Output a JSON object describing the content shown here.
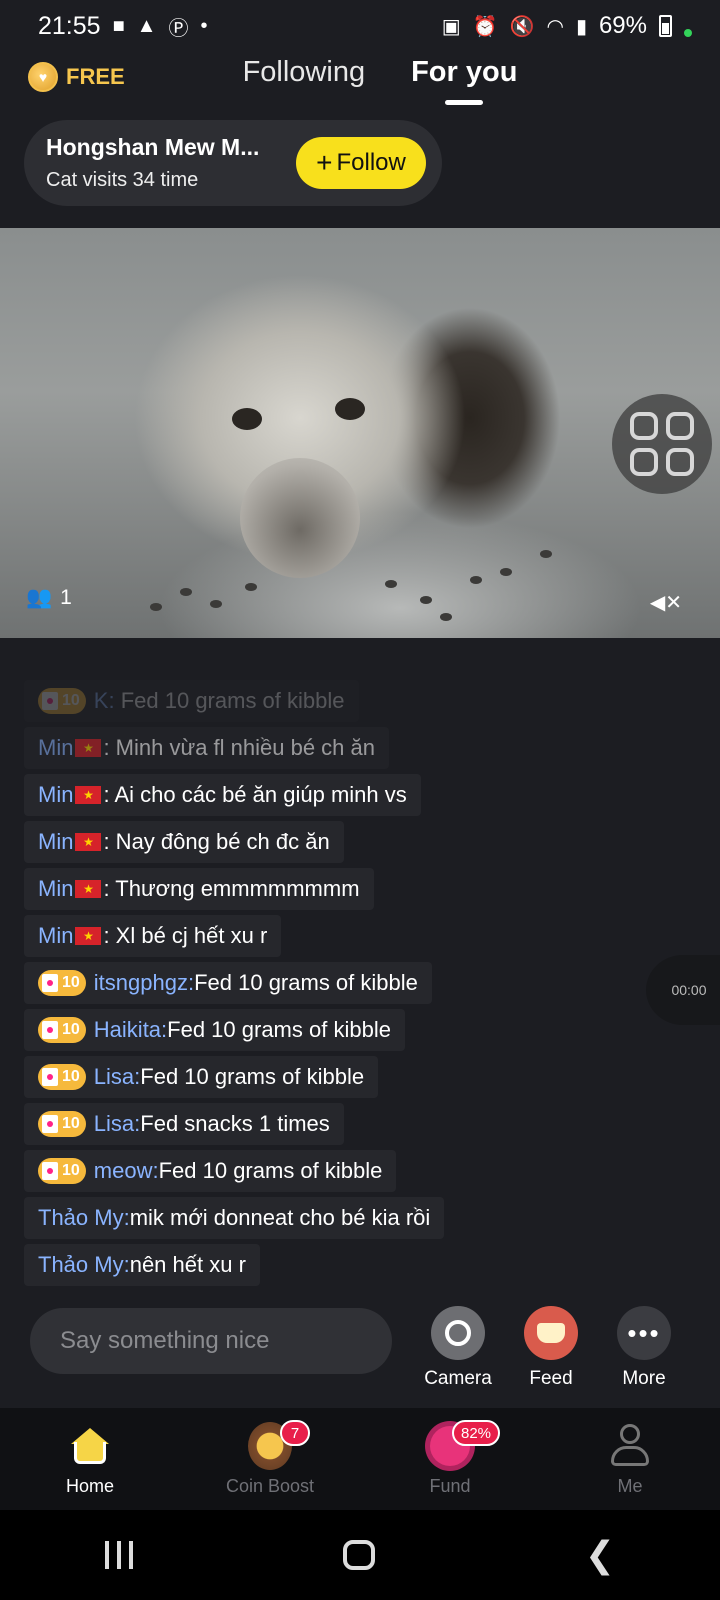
{
  "status_bar": {
    "time": "21:55",
    "battery": "69%",
    "left_icons": [
      "video-icon",
      "warning-icon",
      "p-icon",
      "dot-icon"
    ],
    "right_icons": [
      "lock-icon",
      "alarm-icon",
      "mute-icon",
      "wifi-icon",
      "signal-icon",
      "battery-icon"
    ]
  },
  "header": {
    "free_label": "FREE",
    "tabs": [
      {
        "label": "Following",
        "active": false
      },
      {
        "label": "For you",
        "active": true
      }
    ]
  },
  "follow_card": {
    "title": "Hongshan Mew M...",
    "subtitle": "Cat visits 34 time",
    "button_label": "Follow",
    "button_plus": "+"
  },
  "video": {
    "viewer_count": "1"
  },
  "chat": {
    "messages": [
      {
        "badge": "10",
        "user": "K:",
        "text": "Fed 10 grams of kibble"
      },
      {
        "user": "Min",
        "text": ": Minh vừa fl nhiều bé ch ăn"
      },
      {
        "user": "Min",
        "text": ": Ai cho các bé ăn giúp minh vs"
      },
      {
        "user": "Min",
        "text": ": Nay đông bé ch đc ăn"
      },
      {
        "user": "Min",
        "text": ": Thương emmmmmmmm"
      },
      {
        "user": "Min",
        "text": ": Xl bé cj hết xu r"
      },
      {
        "badge": "10",
        "user": "itsngphgz:",
        "text": " Fed 10 grams of kibble"
      },
      {
        "badge": "10",
        "user": "Haikita:",
        "text": " Fed 10 grams of kibble"
      },
      {
        "badge": "10",
        "user": "Lisa:",
        "text": " Fed 10 grams of kibble"
      },
      {
        "badge": "10",
        "user": "Lisa:",
        "text": " Fed snacks 1 times"
      },
      {
        "badge": "10",
        "user": "meow:",
        "text": " Fed 10 grams of kibble"
      },
      {
        "user": "Thảo My:",
        "text": " mik mới donneat cho bé kia rồi"
      },
      {
        "user": "Thảo My:",
        "text": " nên hết xu r"
      }
    ]
  },
  "timer": "00:00",
  "input": {
    "placeholder": "Say something nice"
  },
  "actions": {
    "camera": "Camera",
    "feed": "Feed",
    "more": "More"
  },
  "bottom_nav": {
    "home": "Home",
    "coin_boost": "Coin Boost",
    "coin_boost_badge": "7",
    "fund": "Fund",
    "fund_badge": "82%",
    "me": "Me"
  }
}
